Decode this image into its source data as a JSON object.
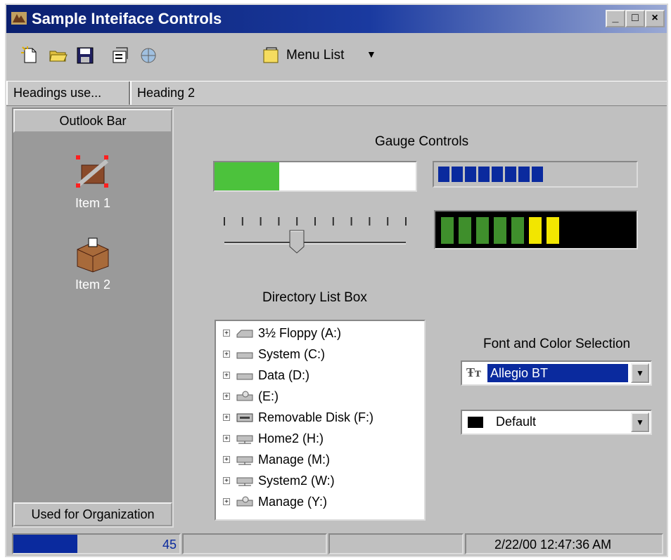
{
  "window": {
    "title": "Sample Inteiface Controls",
    "caption_buttons": {
      "minimize": "_",
      "maximize": "□",
      "close": "×"
    }
  },
  "toolbar": {
    "icons": [
      "new-icon",
      "open-folder-icon",
      "save-icon",
      "properties-icon",
      "globe-icon"
    ],
    "menu_list_label": "Menu List",
    "dropdown_glyph": "▼"
  },
  "tabs": [
    {
      "label": "Headings use..."
    },
    {
      "label": "Heading 2"
    }
  ],
  "outlook_bar": {
    "header": "Outlook Bar",
    "items": [
      {
        "label": "Item 1",
        "icon": "tools-icon"
      },
      {
        "label": "Item 2",
        "icon": "box-icon"
      }
    ],
    "footer": "Used for Organization"
  },
  "gauges": {
    "title": "Gauge Controls",
    "progress_fraction": 0.32,
    "segmented_blue_count": 8,
    "led_colors": [
      "#3f8f2c",
      "#3f8f2c",
      "#3f8f2c",
      "#3f8f2c",
      "#3f8f2c",
      "#f2e600",
      "#f2e600"
    ],
    "slider_position_fraction": 0.4,
    "slider_ticks": 11
  },
  "directory": {
    "title": "Directory List Box",
    "expander_glyph": "+",
    "items": [
      {
        "label": "3½ Floppy (A:)",
        "icon": "floppy-drive-icon"
      },
      {
        "label": "System (C:)",
        "icon": "hard-drive-icon"
      },
      {
        "label": "Data (D:)",
        "icon": "hard-drive-icon"
      },
      {
        "label": "(E:)",
        "icon": "cd-drive-icon"
      },
      {
        "label": "Removable Disk (F:)",
        "icon": "removable-drive-icon"
      },
      {
        "label": "Home2 (H:)",
        "icon": "network-drive-icon"
      },
      {
        "label": "Manage (M:)",
        "icon": "network-drive-icon"
      },
      {
        "label": "System2 (W:)",
        "icon": "network-drive-icon"
      },
      {
        "label": "Manage (Y:)",
        "icon": "cd-drive-icon"
      }
    ]
  },
  "font_color": {
    "title": "Font and Color Selection",
    "font_value": "Allegio BT",
    "font_icon_glyph": "Ŧт",
    "color_value": "Default",
    "color_swatch": "#000000",
    "combo_glyph": "▼"
  },
  "status": {
    "progress_fraction": 0.45,
    "progress_text": "45",
    "timestamp": "2/22/00 12:47:36 AM"
  },
  "colors": {
    "titlebar": "#0a1f6e",
    "highlight": "#0a2a9e",
    "gauge_green": "#4cc23c"
  }
}
